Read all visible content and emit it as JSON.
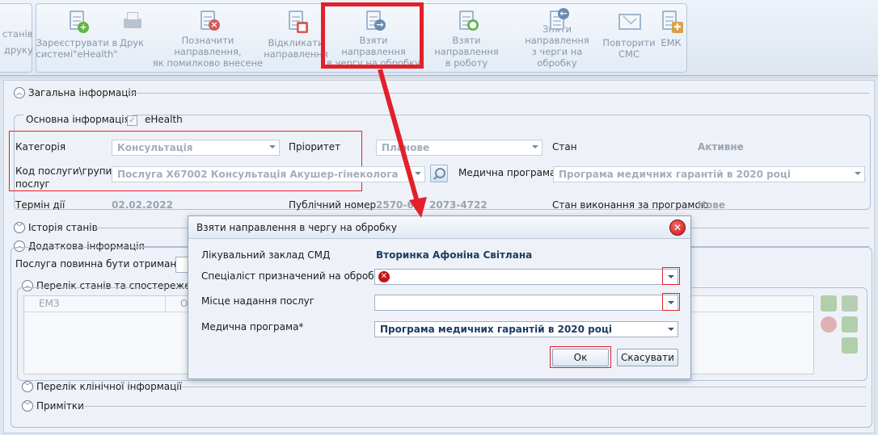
{
  "toolbar": {
    "left_partial_1": "станів",
    "left_partial_2": "друку",
    "buttons": [
      {
        "label": "Зареєструвати в\nсистемі\"eHealth\"",
        "icon": "register-ehealth-icon"
      },
      {
        "label": "Друк",
        "icon": "printer-icon"
      },
      {
        "label": "Позначити направлення,\nяк помилково внесене",
        "icon": "mark-error-icon"
      },
      {
        "label": "Відкликати\nнаправлення",
        "icon": "revoke-icon"
      },
      {
        "label": "Взяти направлення\nв чергу на обробку",
        "icon": "take-to-queue-icon"
      },
      {
        "label": "Взяти направлення\nв роботу",
        "icon": "take-to-work-icon"
      },
      {
        "label": "Зняти направлення\nз черги на обробку",
        "icon": "remove-from-queue-icon"
      },
      {
        "label": "Повторити\nСМС",
        "icon": "sms-icon"
      },
      {
        "label": "ЕМК",
        "icon": "emk-icon"
      }
    ]
  },
  "general": {
    "section_title": "Загальна інформація",
    "basic_info": "Основна інформація",
    "ehealth_label": "eHealth",
    "category_label": "Категорія",
    "category_value": "Консультація",
    "priority_label": "Пріоритет",
    "priority_value": "Планове",
    "state_label": "Стан",
    "state_value": "Активне",
    "service_label": "Код послуги\\групи\nпослуг",
    "service_value": "Послуга X67002 Консультація Акушер-гінеколога",
    "program_label": "Медична програма",
    "program_value": "Програма медичних гарантій в 2020 році",
    "term_label": "Термін дії",
    "term_value": "02.02.2022",
    "public_number_label": "Публічний номер",
    "public_number_value": "2570-61",
    "public_number_value_2": "2073-4722",
    "program_state_label": "Стан виконання за програмою",
    "program_state_value": "Нове"
  },
  "history": {
    "section_title": "Історія станів"
  },
  "extra": {
    "section_title": "Додаткова інформація",
    "must_receive_label": "Послуга повинна бути отримана з",
    "states_title": "Перелік станів та спостереження",
    "grid_columns": [
      "ЕМЗ",
      "Опис"
    ]
  },
  "clinical": {
    "section_title": "Перелік клінічної інформації"
  },
  "notes": {
    "section_title": "Примітки"
  },
  "dialog": {
    "title": "Взяти направлення в чергу на обробку",
    "facility_label": "Лікувальний заклад СМД",
    "facility_value": "Вторинка Афоніна Світлана",
    "specialist_label": "Спеціаліст призначений на обробку*",
    "specialist_value": "",
    "place_label": "Місце надання послуг",
    "place_value": "",
    "program_label": "Медична програма*",
    "program_value": "Програма медичних гарантій в 2020 році",
    "ok_label": "Ок",
    "cancel_label": "Скасувати"
  },
  "colors": {
    "highlight": "#e3202a",
    "accent": "#1f3a64"
  }
}
